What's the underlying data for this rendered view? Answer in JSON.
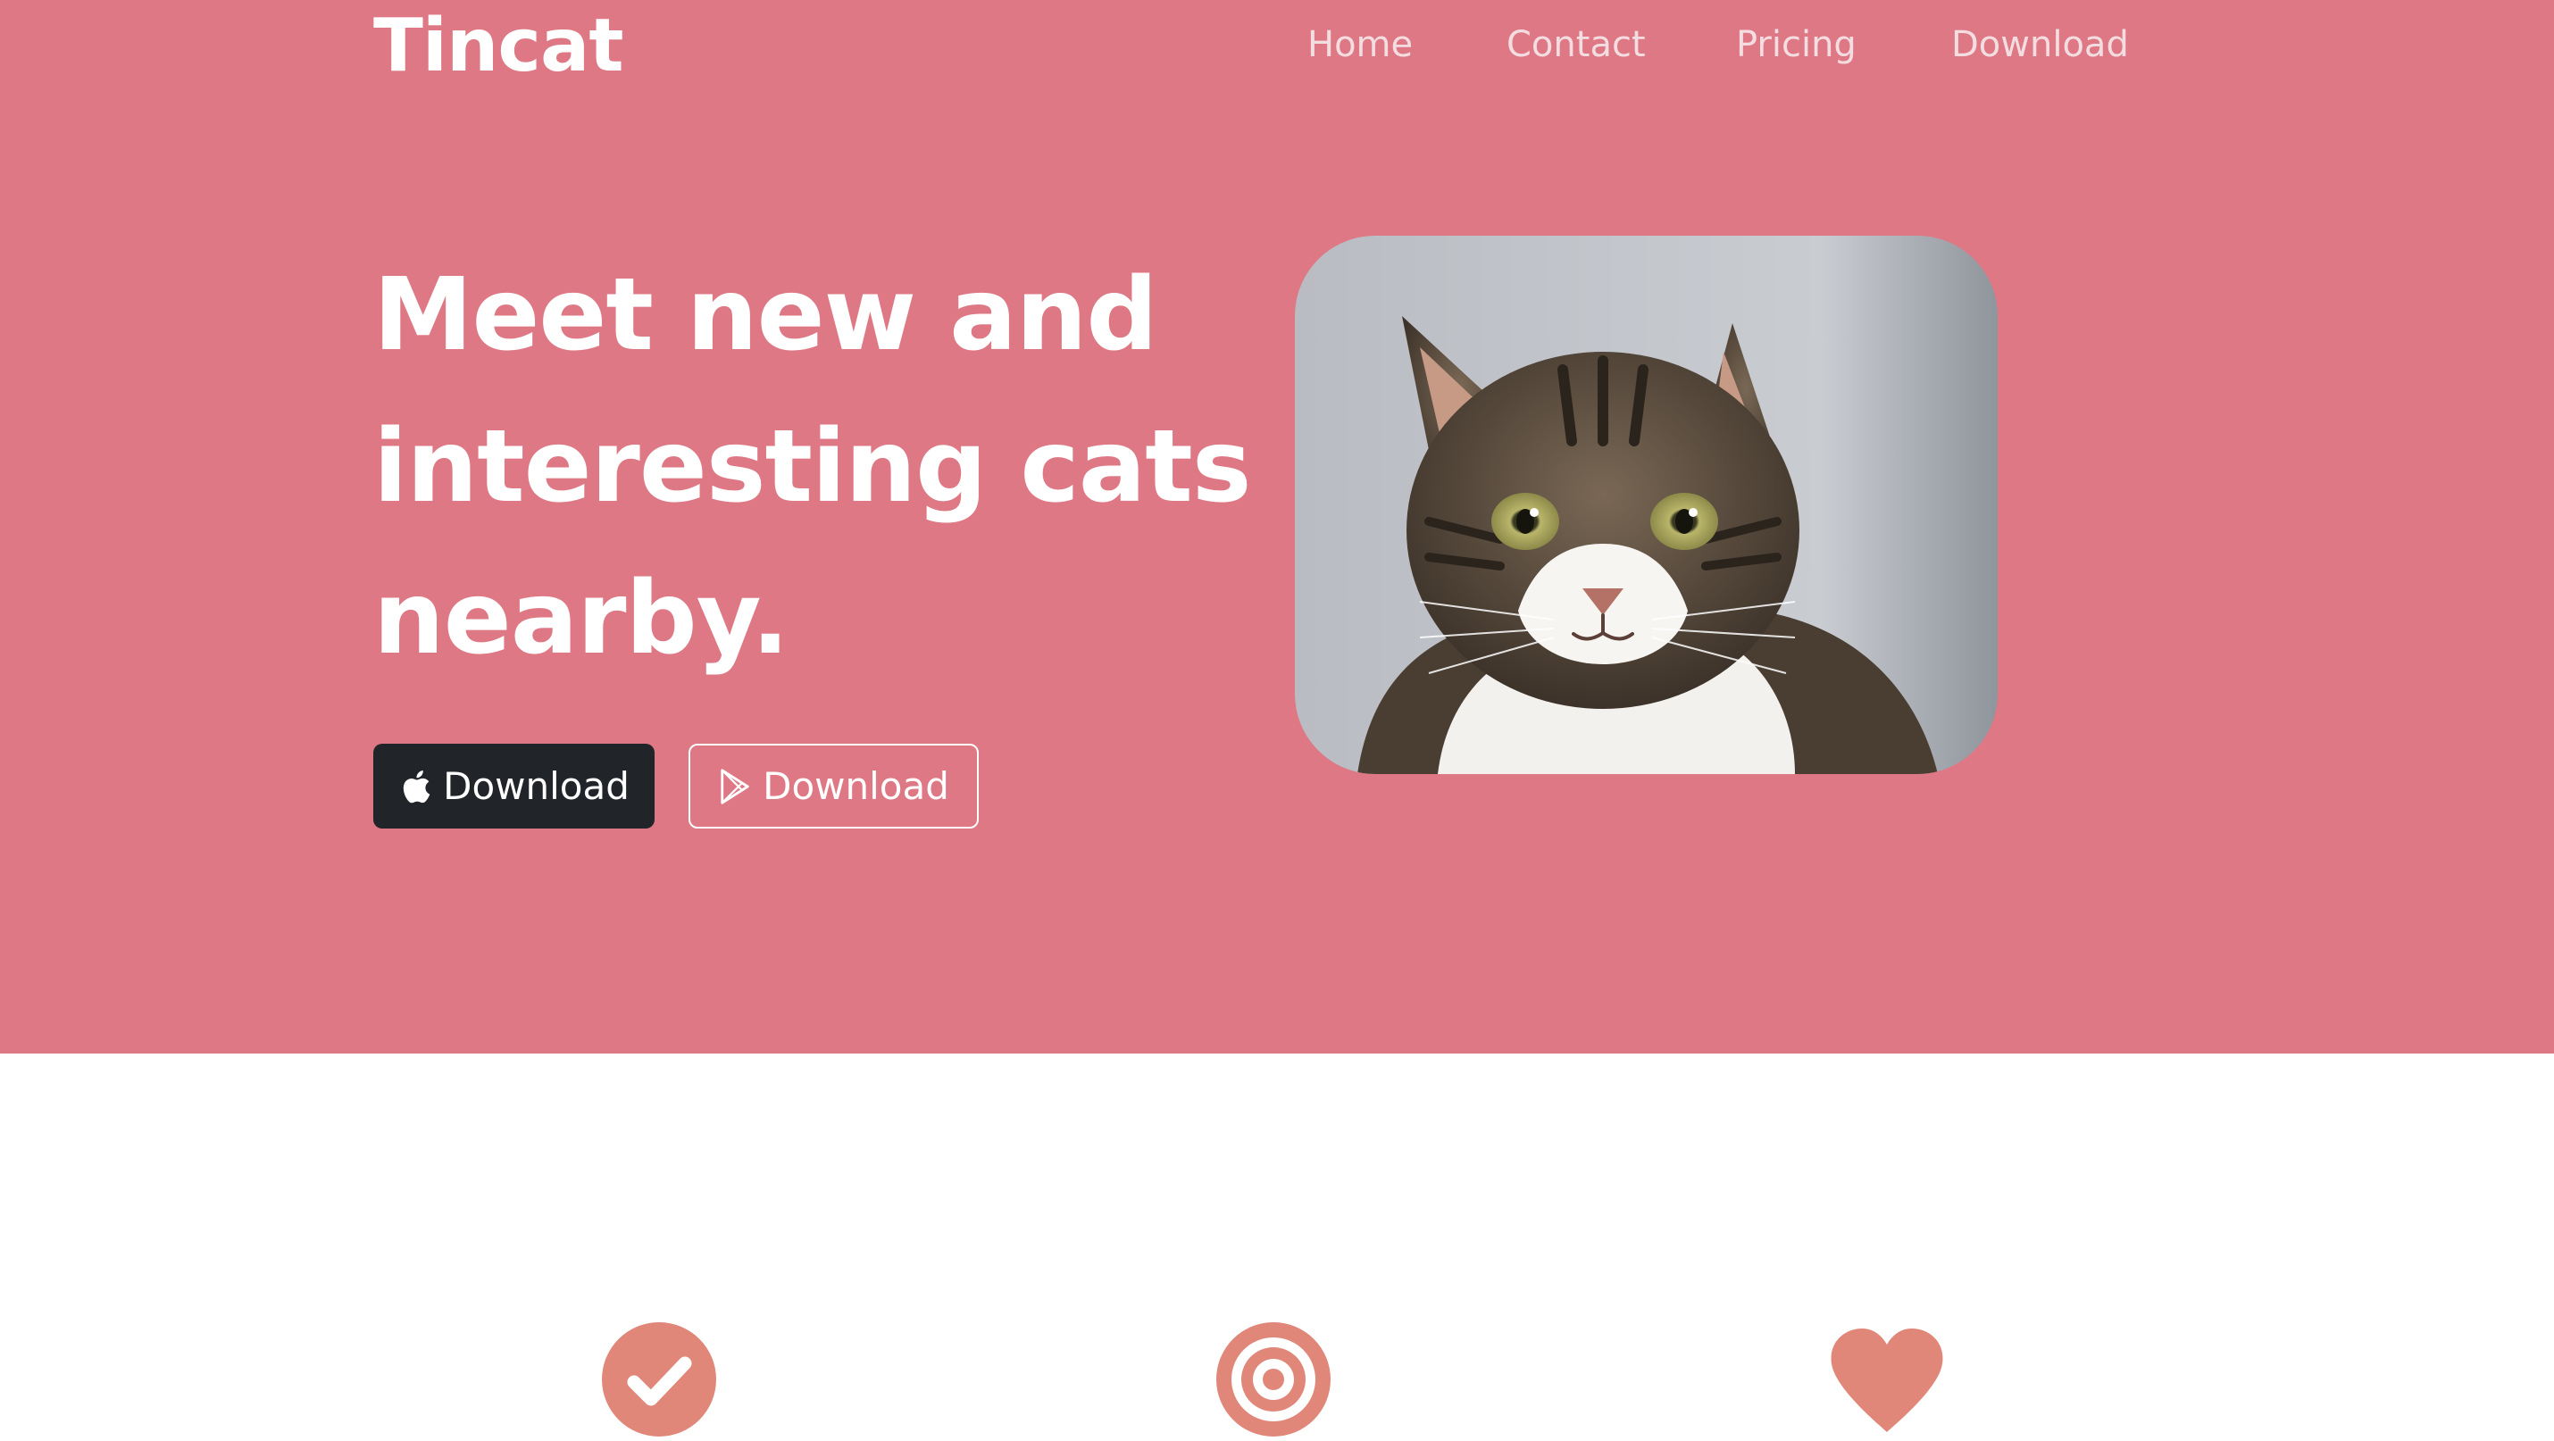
{
  "brand": {
    "name": "Tincat"
  },
  "nav": {
    "items": [
      "Home",
      "Contact",
      "Pricing",
      "Download"
    ]
  },
  "hero": {
    "headline_lines": [
      "Meet new and",
      "interesting cats",
      "nearby."
    ],
    "buttons": {
      "apple_label": "Download",
      "play_label": "Download"
    },
    "image_alt": "tabby cat portrait"
  },
  "colors": {
    "hero_bg": "#df7885",
    "accent_icon": "#e0877a",
    "dark_button": "#212529"
  },
  "icons": {
    "apple": "apple-icon",
    "play": "google-play-icon",
    "features": [
      "check-circle-icon",
      "target-icon",
      "heart-icon"
    ]
  }
}
